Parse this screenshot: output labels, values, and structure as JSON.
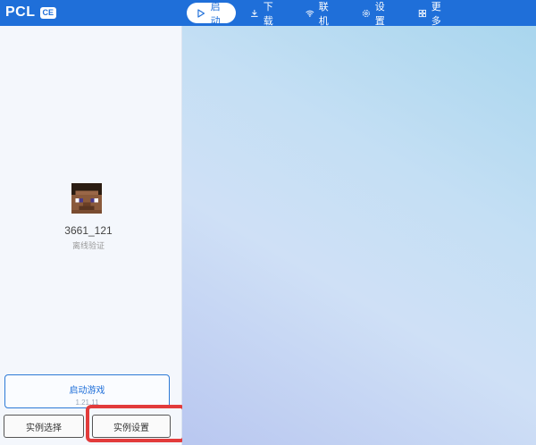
{
  "app": {
    "name": "PCL",
    "badge": "CE"
  },
  "nav": {
    "items": [
      {
        "label": "启动",
        "icon": "play-icon",
        "active": true
      },
      {
        "label": "下载",
        "icon": "download-icon",
        "active": false
      },
      {
        "label": "联机",
        "icon": "wifi-icon",
        "active": false
      },
      {
        "label": "设置",
        "icon": "gear-icon",
        "active": false
      },
      {
        "label": "更多",
        "icon": "grid-icon",
        "active": false
      }
    ]
  },
  "profile": {
    "username": "3661_121",
    "login_type": "离线验证",
    "avatar_icon": "steve-avatar-icon"
  },
  "launch": {
    "title": "启动游戏",
    "version": "1.21.11"
  },
  "buttons": {
    "instance_select": "实例选择",
    "instance_settings": "实例设置"
  },
  "colors": {
    "accent": "#1f6fd9",
    "highlight": "#e23b3b"
  }
}
